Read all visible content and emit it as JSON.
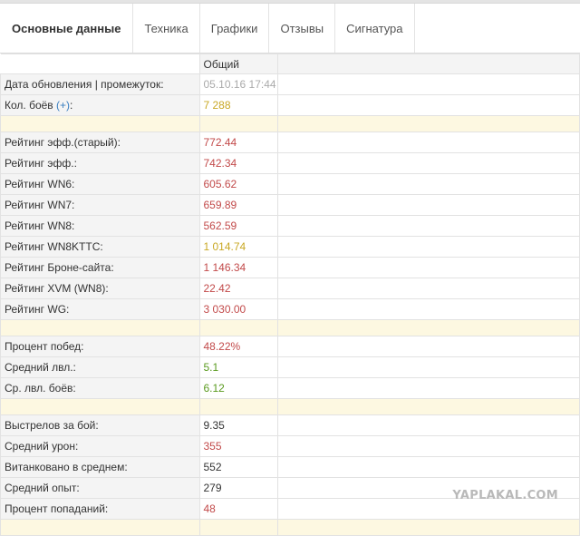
{
  "tabs": [
    {
      "label": "Основные данные",
      "active": true
    },
    {
      "label": "Техника",
      "active": false
    },
    {
      "label": "Графики",
      "active": false
    },
    {
      "label": "Отзывы",
      "active": false
    },
    {
      "label": "Сигнатура",
      "active": false
    }
  ],
  "table": {
    "column_header": "Общий",
    "rows": {
      "update_date": {
        "label": "Дата обновления | промежуток:",
        "value": "05.10.16 17:44"
      },
      "battles": {
        "label": "Кол. боёв",
        "plus": "(+)",
        "suffix": ":",
        "value": "7 288"
      },
      "eff_old": {
        "label": "Рейтинг эфф.(старый):",
        "value": "772.44"
      },
      "eff": {
        "label": "Рейтинг эфф.:",
        "value": "742.34"
      },
      "wn6": {
        "label": "Рейтинг WN6:",
        "value": "605.62"
      },
      "wn7": {
        "label": "Рейтинг WN7:",
        "value": "659.89"
      },
      "wn8": {
        "label": "Рейтинг WN8:",
        "value": "562.59"
      },
      "wn8kttc": {
        "label": "Рейтинг WN8KTTC:",
        "value": "1 014.74"
      },
      "brone": {
        "label": "Рейтинг Броне-сайта:",
        "value": "1 146.34"
      },
      "xvm": {
        "label": "Рейтинг XVM (WN8):",
        "value": "22.42"
      },
      "wg": {
        "label": "Рейтинг WG:",
        "value": "3 030.00"
      },
      "win_pct": {
        "label": "Процент побед:",
        "value": "48.22%"
      },
      "avg_lvl": {
        "label": "Средний лвл.:",
        "value": "5.1"
      },
      "avg_battle_lvl": {
        "label": "Ср. лвл. боёв:",
        "value": "6.12"
      },
      "shots": {
        "label": "Выстрелов за бой:",
        "value": "9.35"
      },
      "avg_dmg": {
        "label": "Средний урон:",
        "value": "355"
      },
      "tanked": {
        "label": "Витанковано в среднем:",
        "value": "552"
      },
      "avg_xp": {
        "label": "Средний опыт:",
        "value": "279"
      },
      "hit_pct": {
        "label": "Процент попаданий:",
        "value": "48"
      }
    }
  },
  "watermark": "YAPLAKAL.COM",
  "colors": {
    "red": "#c24a4a",
    "yellow": "#c9a825",
    "green": "#5a9a1e",
    "gray": "#aaaaaa",
    "spacer": "#fdf8e1"
  }
}
